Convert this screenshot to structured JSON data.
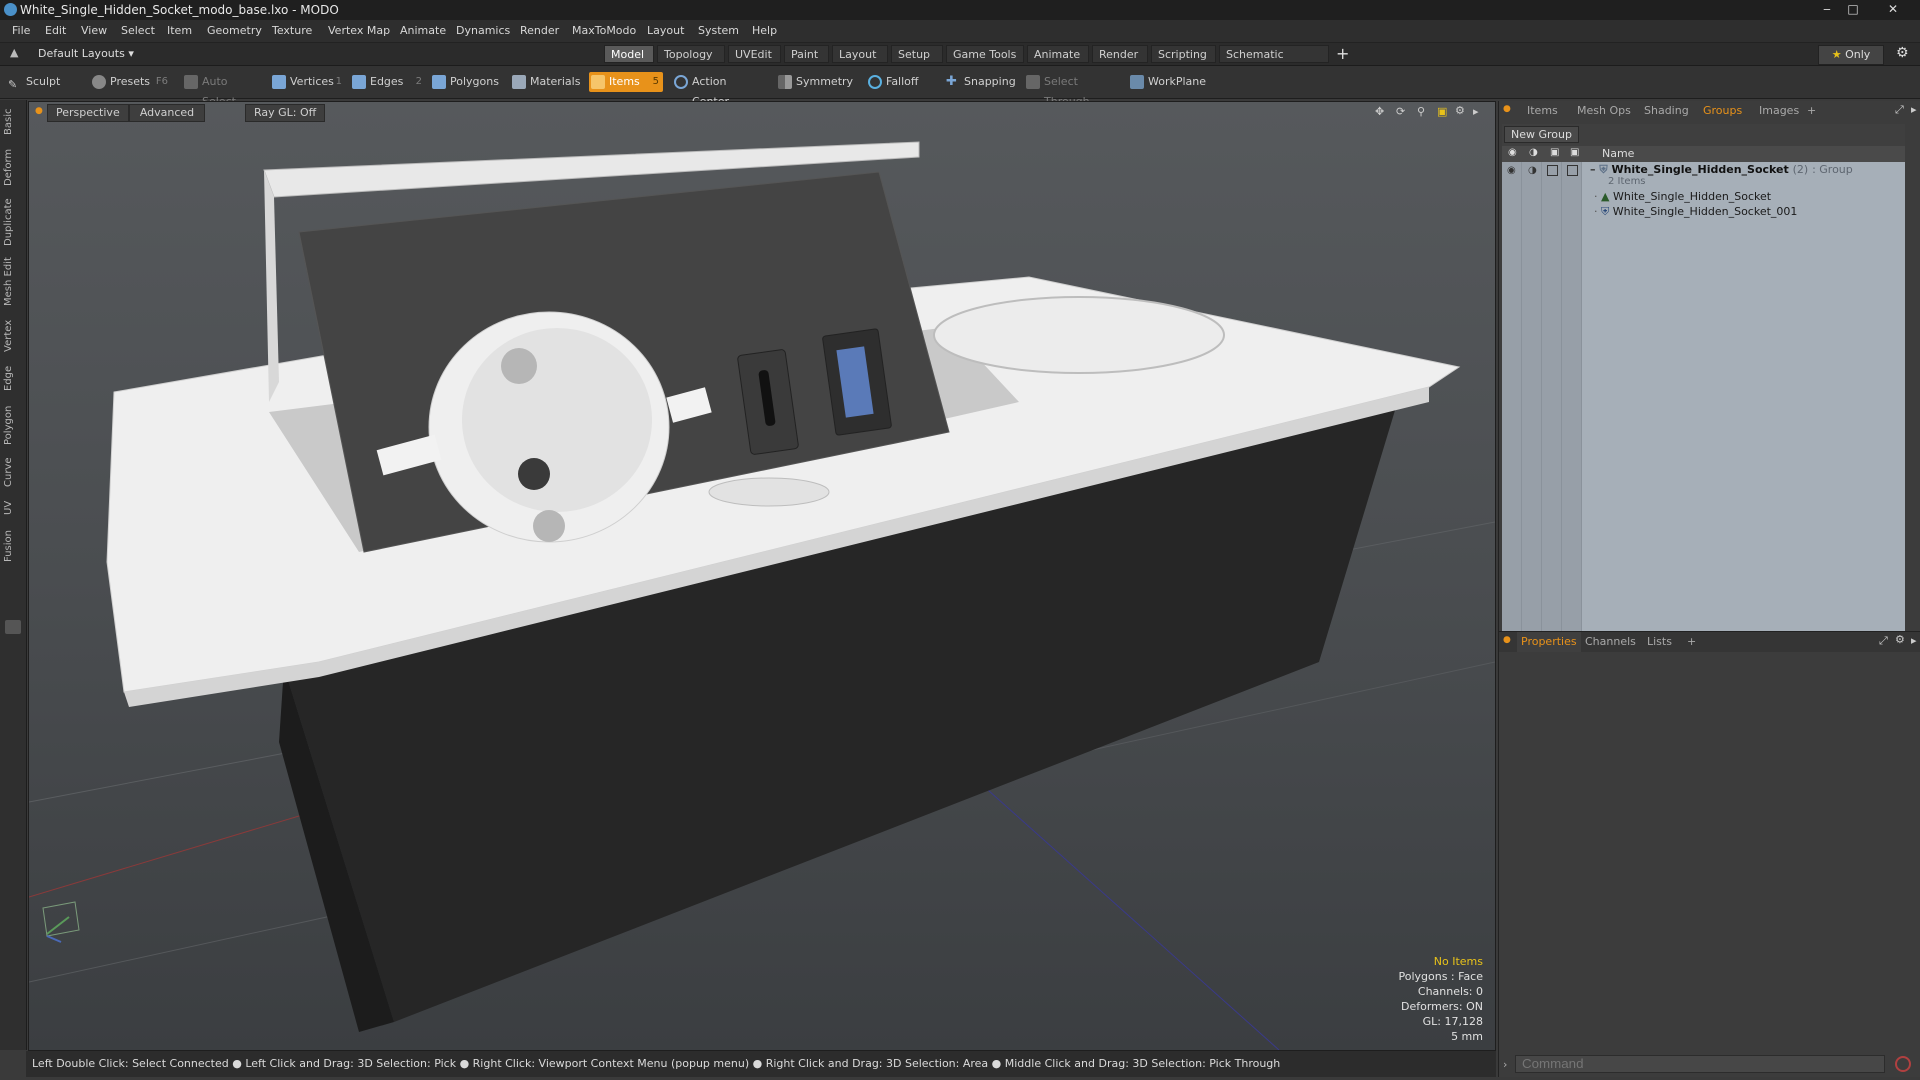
{
  "window": {
    "title": "White_Single_Hidden_Socket_modo_base.lxo - MODO",
    "minimize": "‒",
    "maximize": "□",
    "close": "✕"
  },
  "menu": [
    "File",
    "Edit",
    "View",
    "Select",
    "Item",
    "Geometry",
    "Texture",
    "Vertex Map",
    "Animate",
    "Dynamics",
    "Render",
    "MaxToModo",
    "Layout",
    "System",
    "Help"
  ],
  "layouts": {
    "preset_label": "Default Layouts",
    "tabs": [
      "Model",
      "Topology",
      "UVEdit",
      "Paint",
      "Layout",
      "Setup",
      "Game Tools",
      "Animate",
      "Render",
      "Scripting",
      "Schematic Fusion"
    ],
    "active_tab": "Model",
    "add": "+",
    "only_label": "Only"
  },
  "toolbar": {
    "sculpt": "Sculpt",
    "presets": "Presets",
    "presets_key": "F6",
    "auto_select": "Auto Select",
    "vertices": "Vertices",
    "vertices_key": "1",
    "edges": "Edges",
    "edges_key": "2",
    "polygons": "Polygons",
    "materials": "Materials",
    "items": "Items",
    "items_key": "5",
    "action_center": "Action Center",
    "symmetry": "Symmetry",
    "falloff": "Falloff",
    "snapping": "Snapping",
    "select_through": "Select Through",
    "workplane": "WorkPlane"
  },
  "left_tabs": [
    "Basic",
    "Deform",
    "Duplicate",
    "Mesh Edit",
    "Vertex",
    "Edge",
    "Polygon",
    "Curve",
    "UV",
    "Fusion"
  ],
  "viewport": {
    "view": "Perspective",
    "shading": "Advanced",
    "raygl": "Ray GL: Off",
    "info": {
      "items": "No Items",
      "polygons": "Polygons : Face",
      "channels": "Channels: 0",
      "deformers": "Deformers: ON",
      "gl": "GL: 17,128",
      "scale": "5 mm"
    }
  },
  "status": "Left Double Click: Select Connected ● Left Click and Drag: 3D Selection: Pick ● Right Click: Viewport Context Menu (popup menu) ● Right Click and Drag: 3D Selection: Area ● Middle Click and Drag: 3D Selection: Pick Through",
  "right_panel": {
    "tabs": [
      "Items",
      "Mesh Ops",
      "Shading",
      "Groups",
      "Images"
    ],
    "active_tab": "Groups",
    "new_group": "New Group",
    "name_col": "Name",
    "group": {
      "name": "White_Single_Hidden_Socket",
      "count": "(2)",
      "type": ": Group",
      "items": "2 Items"
    },
    "children": [
      "White_Single_Hidden_Socket",
      "White_Single_Hidden_Socket_001"
    ],
    "lower_tabs": [
      "Properties",
      "Channels",
      "Lists"
    ],
    "lower_active": "Properties",
    "command_placeholder": "Command"
  },
  "colors": {
    "accent": "#e8921a"
  }
}
